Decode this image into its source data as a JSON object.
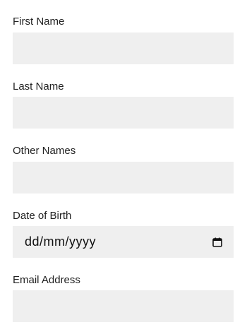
{
  "fields": [
    {
      "label": "First Name",
      "value": "",
      "placeholder": ""
    },
    {
      "label": "Last Name",
      "value": "",
      "placeholder": ""
    },
    {
      "label": "Other Names",
      "value": "",
      "placeholder": ""
    },
    {
      "label": "Date of Birth",
      "value": "dd/mm/yyyy"
    },
    {
      "label": "Email Address",
      "value": "",
      "placeholder": ""
    }
  ],
  "icons": {
    "date_picker": "calendar-icon"
  },
  "colors": {
    "field_background": "#efefef",
    "label_text": "#222222",
    "input_text": "#111111"
  }
}
